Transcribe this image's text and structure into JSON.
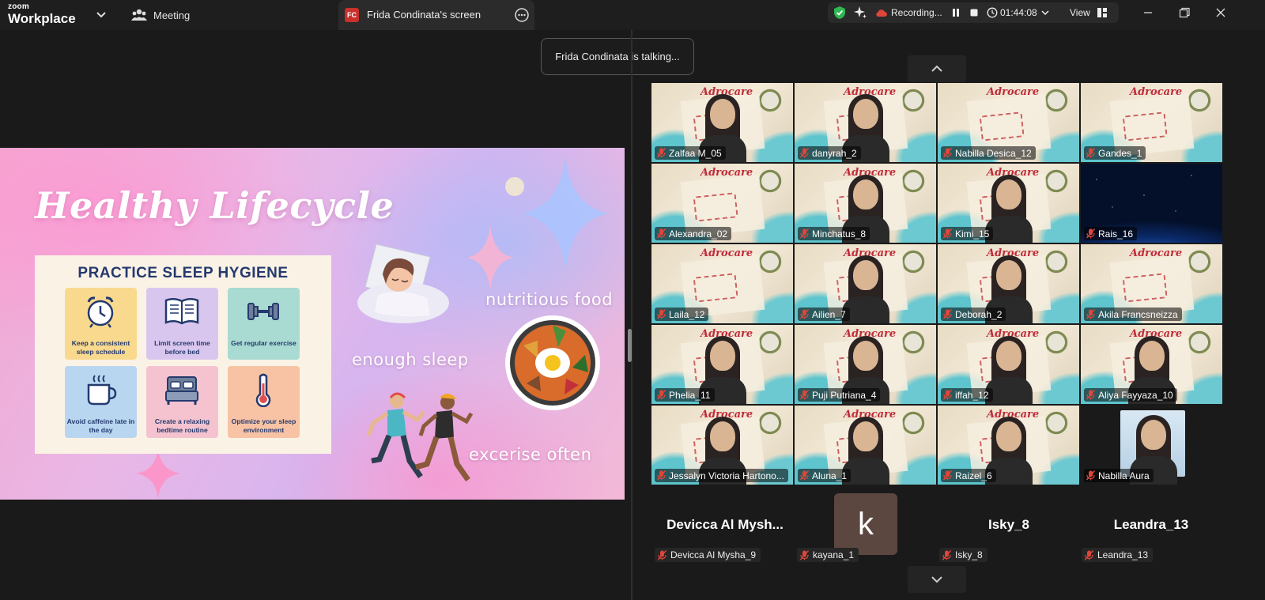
{
  "app": {
    "logo_top": "zoom",
    "logo_bottom": "Workplace",
    "meeting_tab": "Meeting",
    "screen_tab_badge": "FC",
    "screen_tab_label": "Frida Condinata's screen"
  },
  "status": {
    "recording_label": "Recording...",
    "timer": "01:44:08",
    "view_label": "View"
  },
  "toast": "Frida Condinata is talking...",
  "slide": {
    "title": "Healthy Lifecycle",
    "card_title": "PRACTICE SLEEP HYGIENE",
    "items": [
      {
        "label": "Keep a consistent sleep schedule",
        "icon": "alarm-clock-icon",
        "color": "#f9d98d"
      },
      {
        "label": "Limit screen time before bed",
        "icon": "book-icon",
        "color": "#d9c6ee"
      },
      {
        "label": "Get regular exercise",
        "icon": "dumbbell-icon",
        "color": "#a9dbd2"
      },
      {
        "label": "Avoid caffeine late in the day",
        "icon": "coffee-cup-icon",
        "color": "#b9d6f1"
      },
      {
        "label": "Create a relaxing bedtime routine",
        "icon": "bed-icon",
        "color": "#f4c3cf"
      },
      {
        "label": "Optimize your sleep environment",
        "icon": "thermometer-icon",
        "color": "#f8c3a4"
      }
    ],
    "caption_sleep": "enough sleep",
    "caption_food": "nutritious food",
    "caption_exercise": "excerise often",
    "tile_brand": "Adrocare"
  },
  "participants": [
    "Zalfaa M_05",
    "danyrah_2",
    "Nabilla Desica_12",
    "Gandes_1",
    "Alexandra_02",
    "Minchatus_8",
    "Kimi_15",
    "Rais_16",
    "Laila_12",
    "Ailien_7",
    "Deborah_2",
    "Akila Francsneizza",
    "Phelia_11",
    "Puji Putriana_4",
    "iffah_12",
    "Aliya Fayyaza_10",
    "Jessalyn Victoria Hartono...",
    "Aluna_1",
    "Raizel_6",
    "Nabilla Aura"
  ],
  "audio_only": [
    {
      "display": "Devicca  Al  Mysh...",
      "tag": "Devicca Al Mysha_9"
    },
    {
      "display": "k",
      "tag": "kayana_1"
    },
    {
      "display": "Isky_8",
      "tag": "Isky_8"
    },
    {
      "display": "Leandra_13",
      "tag": "Leandra_13"
    }
  ],
  "colors": {
    "background": "#1a1a1a",
    "topbar": "#1e1e1e",
    "badge": "#c8302c",
    "shield": "#2fb551",
    "record_dot": "#e0453a",
    "avatar_k": "#5c4740"
  }
}
